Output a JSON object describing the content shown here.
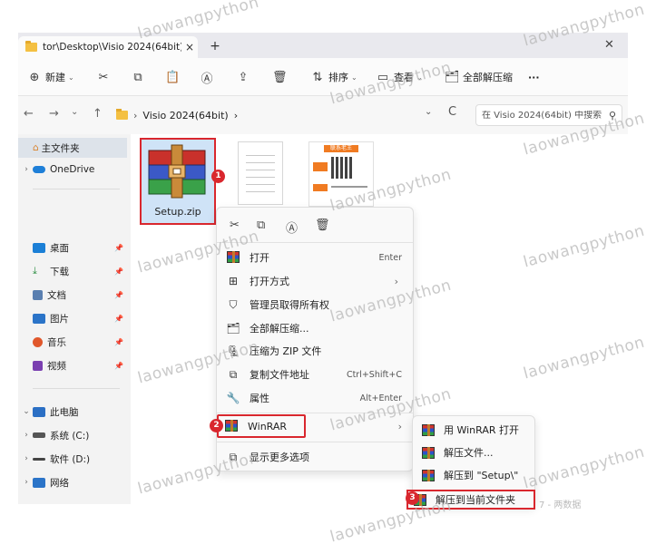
{
  "window": {
    "tab_title": "tor\\Desktop\\Visio 2024(64bit)",
    "tab_close": "×",
    "new_tab": "+",
    "close": "✕"
  },
  "toolbar": {
    "new_label": "新建",
    "sort_label": "排序",
    "view_label": "查看",
    "extract_all_label": "全部解压缩",
    "more_label": "···"
  },
  "address": {
    "back": "←",
    "forward": "→",
    "recent": "⌄",
    "up": "↑",
    "crumb_sep": "›",
    "path": "Visio 2024(64bit)",
    "path_chevron": "›",
    "dropdown": "⌄",
    "refresh": "C",
    "search_placeholder": "在 Visio 2024(64bit) 中搜索"
  },
  "sidebar": {
    "home": "主文件夹",
    "onedrive": "OneDrive",
    "quick": [
      {
        "label": "桌面",
        "color": "#1b7fd6"
      },
      {
        "label": "下载",
        "color": "#2a8c3f"
      },
      {
        "label": "文档",
        "color": "#5a7fb0"
      },
      {
        "label": "图片",
        "color": "#2b74c8"
      },
      {
        "label": "音乐",
        "color": "#e0572b"
      },
      {
        "label": "视频",
        "color": "#7a3fb0"
      }
    ],
    "this_pc": "此电脑",
    "drive_c": "系统 (C:)",
    "drive_d": "软件 (D:)",
    "network": "网络"
  },
  "files": {
    "setup_name": "Setup.zip",
    "qr_header": "联系老王"
  },
  "context_menu": {
    "items": [
      {
        "label": "打开",
        "shortcut": "Enter"
      },
      {
        "label": "打开方式",
        "arrow": "›"
      },
      {
        "label": "管理员取得所有权"
      },
      {
        "label": "全部解压缩..."
      },
      {
        "label": "压缩为 ZIP 文件"
      },
      {
        "label": "复制文件地址",
        "shortcut": "Ctrl+Shift+C"
      },
      {
        "label": "属性",
        "shortcut": "Alt+Enter"
      }
    ],
    "winrar_label": "WinRAR",
    "winrar_arrow": "›",
    "more_options": "显示更多选项"
  },
  "submenu": {
    "items": [
      {
        "label": "用 WinRAR 打开"
      },
      {
        "label": "解压文件..."
      },
      {
        "label": "解压到 \"Setup\\\""
      },
      {
        "label": "解压到当前文件夹"
      }
    ]
  },
  "badges": [
    "1",
    "2",
    "3"
  ],
  "watermark": "laowangpython",
  "ghost_text": "7 - 两数据"
}
